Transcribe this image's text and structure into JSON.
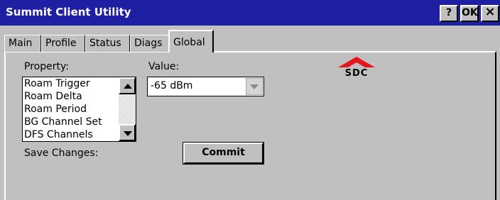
{
  "window": {
    "title": "Summit Client Utility",
    "buttons": {
      "help": "?",
      "ok": "OK",
      "close": "×"
    }
  },
  "tabs": [
    {
      "label": "Main"
    },
    {
      "label": "Profile"
    },
    {
      "label": "Status"
    },
    {
      "label": "Diags"
    },
    {
      "label": "Global",
      "active": true
    }
  ],
  "global": {
    "property_label": "Property:",
    "value_label": "Value:",
    "properties": [
      "Roam Trigger",
      "Roam Delta",
      "Roam Period",
      "BG Channel Set",
      "DFS Channels"
    ],
    "value": "-65 dBm",
    "save_changes_label": "Save Changes:",
    "commit_label": "Commit"
  },
  "logo": {
    "text": "SDC",
    "color": "#e8141d"
  },
  "colors": {
    "titlebar": "#1f1fa3",
    "face": "#c0c0c0"
  }
}
